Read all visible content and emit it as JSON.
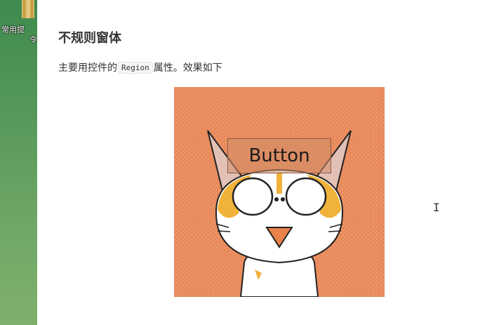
{
  "desktop": {
    "icon_name": "folder-icon",
    "label_line1": "常用提",
    "label_line2": "令"
  },
  "article": {
    "heading": "不规则窗体",
    "para_before": "主要用控件的",
    "para_code": "Region",
    "para_after": "属性。效果如下"
  },
  "figure": {
    "alt": "irregular form demo with cat shape",
    "button_label": "Button",
    "background_color": "#e8895a"
  },
  "cursor": {
    "icon_name": "text-cursor-icon",
    "glyph": "I"
  }
}
